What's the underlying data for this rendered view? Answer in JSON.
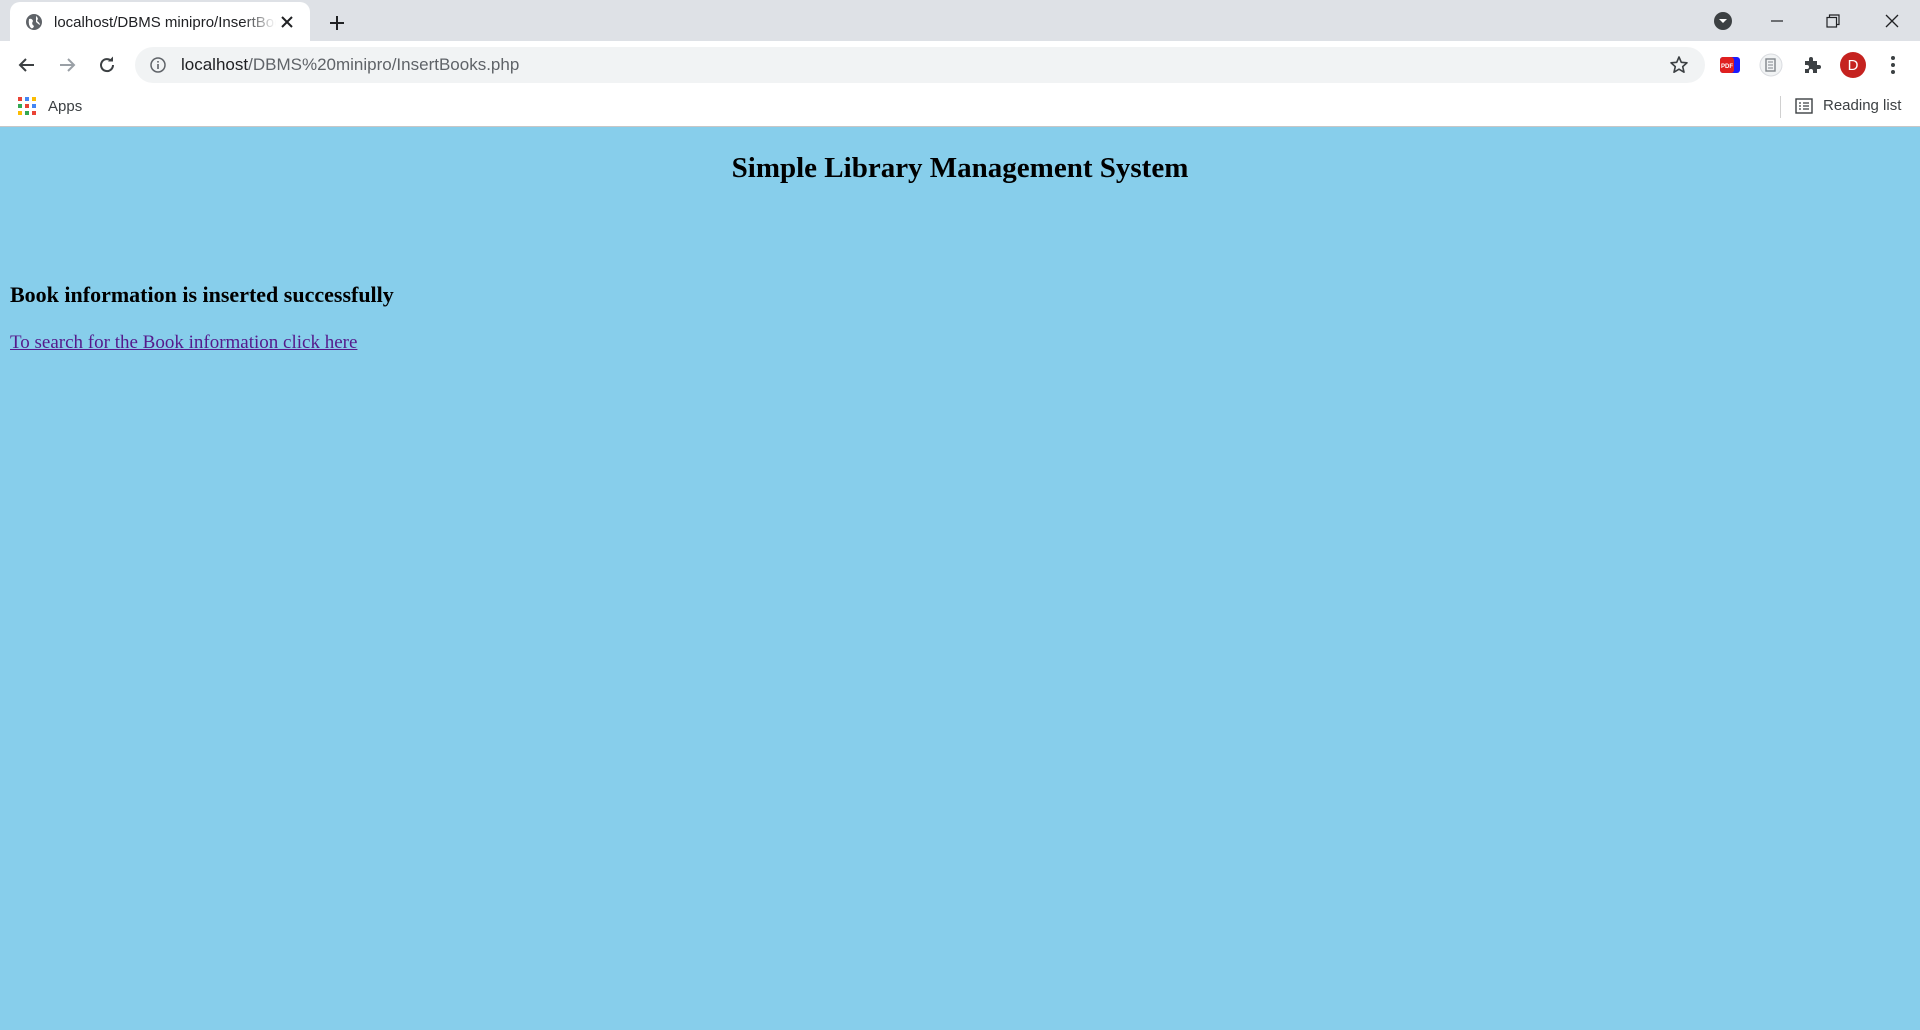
{
  "browser": {
    "tab": {
      "title": "localhost/DBMS minipro/InsertBooks.php",
      "favicon": "globe-icon"
    },
    "address_bar": {
      "host": "localhost",
      "path": "/DBMS%20minipro/InsertBooks.php"
    },
    "profile_initial": "D",
    "profile_color": "#c5221f",
    "bookmarks_bar": {
      "apps_label": "Apps",
      "reading_list_label": "Reading list"
    }
  },
  "page": {
    "background": "#87ceeb",
    "title": "Simple Library Management System",
    "message": "Book information is inserted successfully",
    "link_text": "To search for the Book information click here",
    "link_color": "#551a8b"
  }
}
